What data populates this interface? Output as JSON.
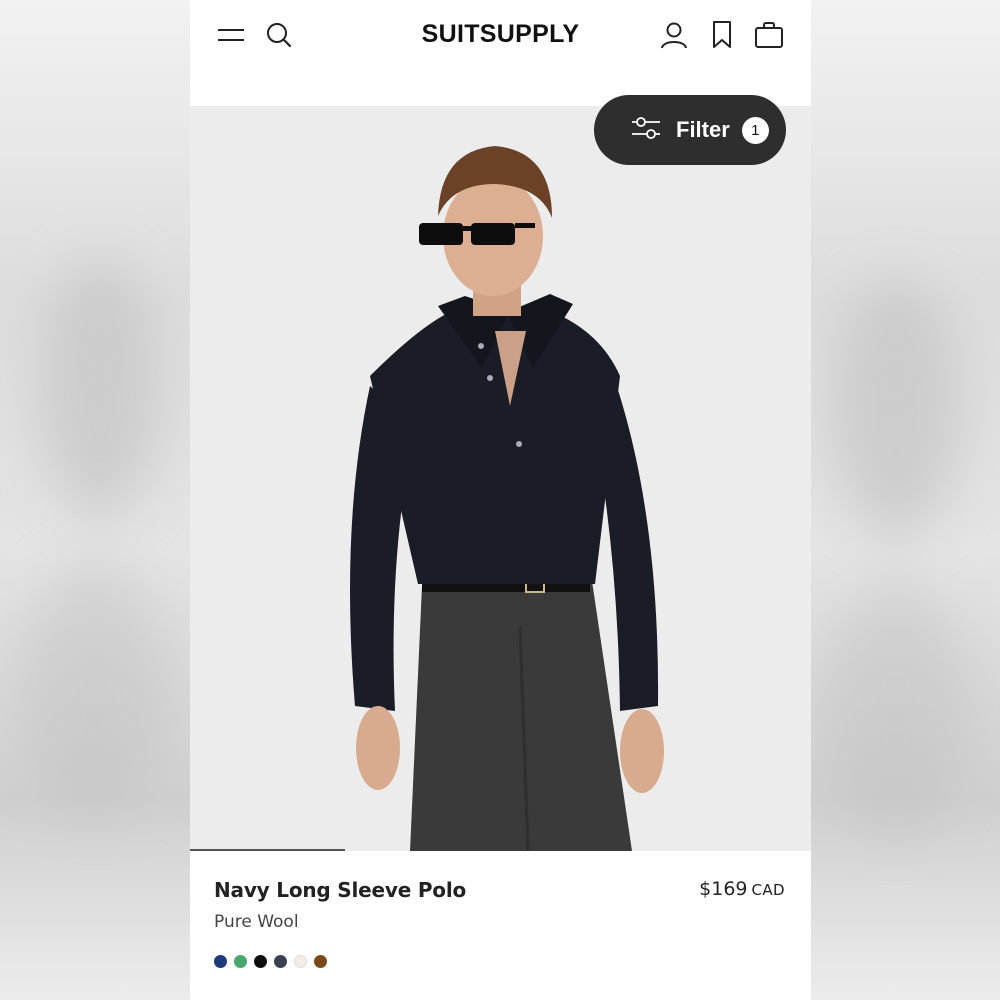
{
  "header": {
    "brand": "SUITSUPPLY",
    "icons": {
      "menu": "menu-icon",
      "search": "search-icon",
      "account": "user-icon",
      "wishlist": "bookmark-icon",
      "bag": "shopping-bag-icon"
    }
  },
  "filter": {
    "label": "Filter",
    "count": "1",
    "icon": "sliders-icon"
  },
  "gallery": {
    "progress": 0.25
  },
  "product": {
    "name": "Navy Long Sleeve Polo",
    "material": "Pure Wool",
    "price": "$169",
    "currency": "CAD",
    "swatches": [
      "#1f3a78",
      "#46a86a",
      "#0e0e0e",
      "#3b4150",
      "#f1ede6",
      "#7a4a1a"
    ]
  },
  "colors": {
    "filter_bg": "#2e2e2e",
    "photo_bg": "#ececec",
    "shirt": "#1b1d26",
    "trousers": "#3a3a3a"
  }
}
